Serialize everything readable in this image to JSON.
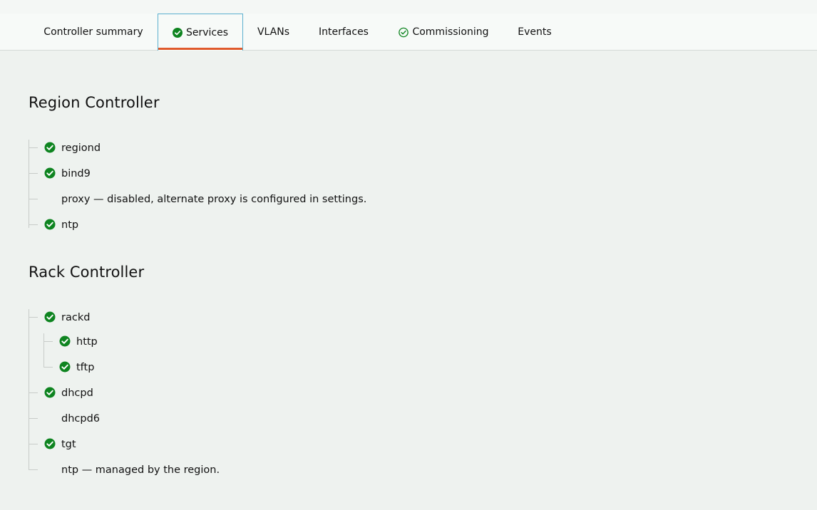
{
  "tabs": [
    {
      "label": "Controller summary",
      "icon": null,
      "active": false
    },
    {
      "label": "Services",
      "icon": "check-circle-filled-icon",
      "active": true
    },
    {
      "label": "VLANs",
      "icon": null,
      "active": false
    },
    {
      "label": "Interfaces",
      "icon": null,
      "active": false
    },
    {
      "label": "Commissioning",
      "icon": "check-circle-outline-icon",
      "active": false
    },
    {
      "label": "Events",
      "icon": null,
      "active": false
    }
  ],
  "colors": {
    "success": "#0e8420",
    "active_tab_underline": "#e05a2c",
    "active_tab_border": "#5bb0cf"
  },
  "region": {
    "title": "Region Controller",
    "services": [
      {
        "name": "regiond",
        "status": "running"
      },
      {
        "name": "bind9",
        "status": "running"
      },
      {
        "name": "proxy — disabled, alternate proxy is configured in settings.",
        "status": "none"
      },
      {
        "name": "ntp",
        "status": "running"
      }
    ]
  },
  "rack": {
    "title": "Rack Controller",
    "services": [
      {
        "name": "rackd",
        "status": "running",
        "children": [
          {
            "name": "http",
            "status": "running"
          },
          {
            "name": "tftp",
            "status": "running"
          }
        ]
      },
      {
        "name": "dhcpd",
        "status": "running"
      },
      {
        "name": "dhcpd6",
        "status": "none"
      },
      {
        "name": "tgt",
        "status": "running"
      },
      {
        "name": "ntp — managed by the region.",
        "status": "none"
      }
    ]
  }
}
